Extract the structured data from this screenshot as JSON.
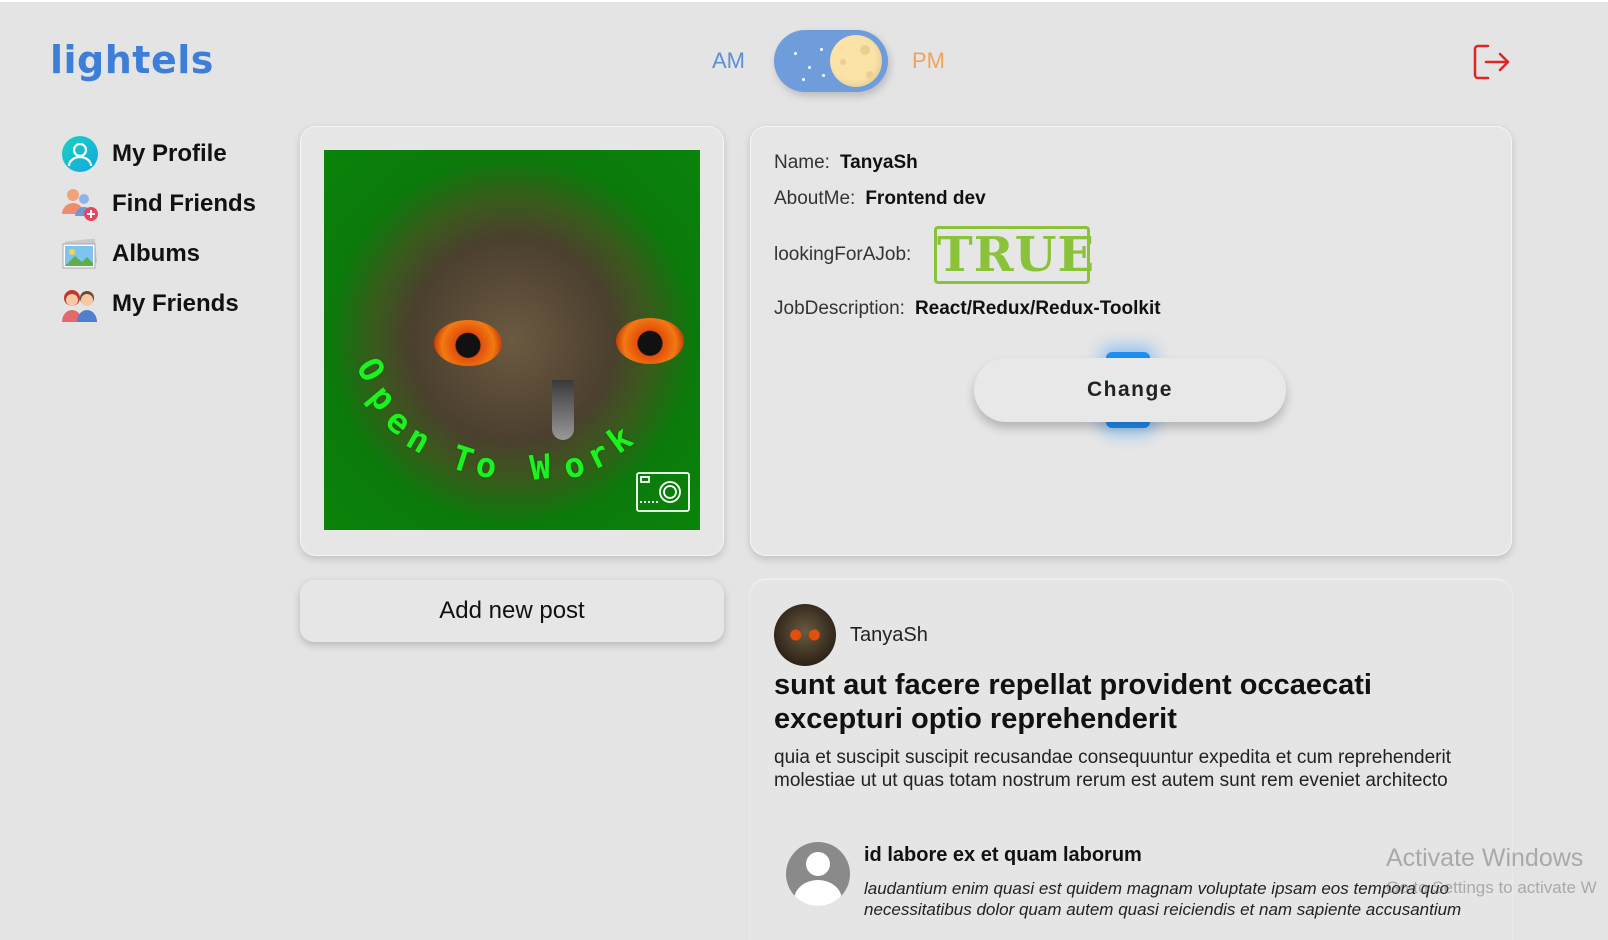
{
  "header": {
    "logo": "lightels",
    "am_label": "AM",
    "pm_label": "PM",
    "theme_toggle_icon": "moon-toggle",
    "logout_icon": "logout-icon",
    "colors": {
      "logo": "#3d7fd8",
      "am": "#5b8fd6",
      "pm": "#f0a35a",
      "logout": "#e02424"
    }
  },
  "sidebar": {
    "items": [
      {
        "label": "My Profile",
        "icon": "profile-icon"
      },
      {
        "label": "Find Friends",
        "icon": "find-friends-icon"
      },
      {
        "label": "Albums",
        "icon": "albums-icon"
      },
      {
        "label": "My Friends",
        "icon": "friends-icon"
      }
    ]
  },
  "profile": {
    "avatar_caption": "Open To Work",
    "camera_icon": "camera-icon",
    "fields": {
      "name_label": "Name:",
      "name_value": "TanyaSh",
      "about_label": "AboutMe:",
      "about_value": "Frontend dev",
      "looking_label": "lookingForAJob:",
      "looking_value": "TRUE",
      "job_label": "JobDescription:",
      "job_value": "React/Redux/Redux-Toolkit"
    },
    "change_button": "Change"
  },
  "add_post_button": "Add new post",
  "post": {
    "author": "TanyaSh",
    "title": "sunt aut facere repellat provident occaecati excepturi optio reprehenderit",
    "body": "quia et suscipit suscipit recusandae consequuntur expedita et cum reprehenderit molestiae ut ut quas totam nostrum rerum est autem sunt rem eveniet architecto",
    "comment": {
      "title": "id labore ex et quam laborum",
      "body": "laudantium enim quasi est quidem magnam voluptate ipsam eos tempora quo necessitatibus dolor quam autem quasi reiciendis et nam sapiente accusantium"
    }
  },
  "watermark": {
    "line1": "Activate Windows",
    "line2": "Go to Settings to activate W"
  }
}
